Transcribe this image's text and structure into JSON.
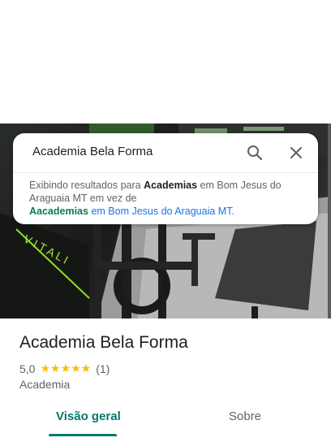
{
  "search": {
    "query": "Academia Bela Forma",
    "search_icon": "search-icon",
    "close_icon": "close-icon"
  },
  "notice": {
    "line1_prefix": "Exibindo resultados para ",
    "line1_term": "Academias",
    "line1_suffix": " em Bom Jesus do Araguaia MT em vez de",
    "line2_term": "Aacademias",
    "line2_suffix": " em Bom Jesus do Araguaia MT."
  },
  "hero": {
    "wall_text": "V I T A L I"
  },
  "place": {
    "title": "Academia Bela Forma",
    "rating": "5,0",
    "stars": "★★★★★",
    "review_count": "(1)",
    "category": "Academia"
  },
  "tabs": [
    {
      "label": "Visão geral",
      "active": true
    },
    {
      "label": "Sobre",
      "active": false
    }
  ],
  "colors": {
    "accent": "#00796b",
    "star": "#fbbc04",
    "link": "#1a73e8"
  }
}
